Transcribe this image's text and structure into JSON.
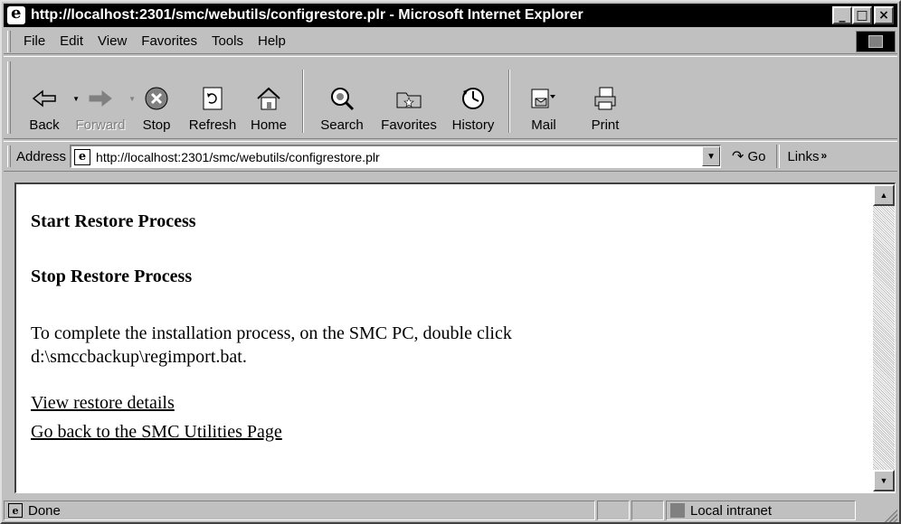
{
  "window": {
    "title": "http://localhost:2301/smc/webutils/configrestore.plr - Microsoft Internet Explorer",
    "minimize": "_",
    "maximize": "□",
    "close": "×"
  },
  "menu": {
    "items": [
      {
        "label": "File"
      },
      {
        "label": "Edit"
      },
      {
        "label": "View"
      },
      {
        "label": "Favorites"
      },
      {
        "label": "Tools"
      },
      {
        "label": "Help"
      }
    ]
  },
  "toolbar": {
    "buttons": [
      {
        "label": "Back",
        "icon": "back-arrow-icon"
      },
      {
        "label": "Forward",
        "icon": "forward-arrow-icon"
      },
      {
        "label": "Stop",
        "icon": "stop-icon"
      },
      {
        "label": "Refresh",
        "icon": "refresh-icon"
      },
      {
        "label": "Home",
        "icon": "home-icon"
      },
      {
        "label": "Search",
        "icon": "search-icon"
      },
      {
        "label": "Favorites",
        "icon": "favorites-icon"
      },
      {
        "label": "History",
        "icon": "history-icon"
      },
      {
        "label": "Mail",
        "icon": "mail-icon"
      },
      {
        "label": "Print",
        "icon": "print-icon"
      }
    ]
  },
  "address": {
    "label": "Address",
    "url": "http://localhost:2301/smc/webutils/configrestore.plr",
    "go_label": "Go",
    "links_label": "Links"
  },
  "page": {
    "heading1": "Start Restore Process",
    "heading2": "Stop Restore Process",
    "instruction_line1": "To complete the installation process, on the SMC PC, double click",
    "instruction_line2": "d:\\smccbackup\\regimport.bat.",
    "link1": "View restore details",
    "link2": "Go back to the SMC Utilities Page"
  },
  "status": {
    "text": "Done",
    "zone": "Local intranet"
  }
}
